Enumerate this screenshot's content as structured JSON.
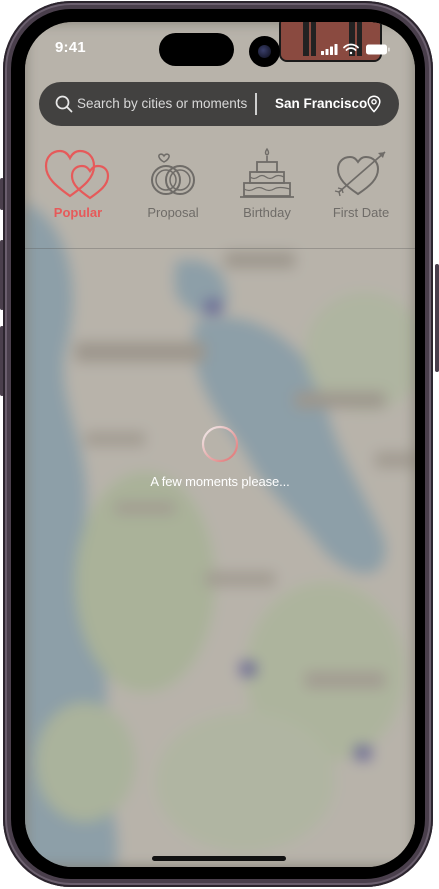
{
  "status_bar": {
    "time": "9:41"
  },
  "search": {
    "placeholder": "Search by cities or moments",
    "city": "San Francisco"
  },
  "categories": [
    {
      "label": "Popular",
      "icon": "hearts-icon",
      "active": true
    },
    {
      "label": "Proposal",
      "icon": "rings-icon",
      "active": false
    },
    {
      "label": "Birthday",
      "icon": "cake-icon",
      "active": false
    },
    {
      "label": "First Date",
      "icon": "heart-arrow-icon",
      "active": false
    }
  ],
  "loading": {
    "message": "A few moments please..."
  },
  "colors": {
    "accent": "#e65a5a",
    "muted": "#6f6c68",
    "search_bg": "#282828"
  }
}
